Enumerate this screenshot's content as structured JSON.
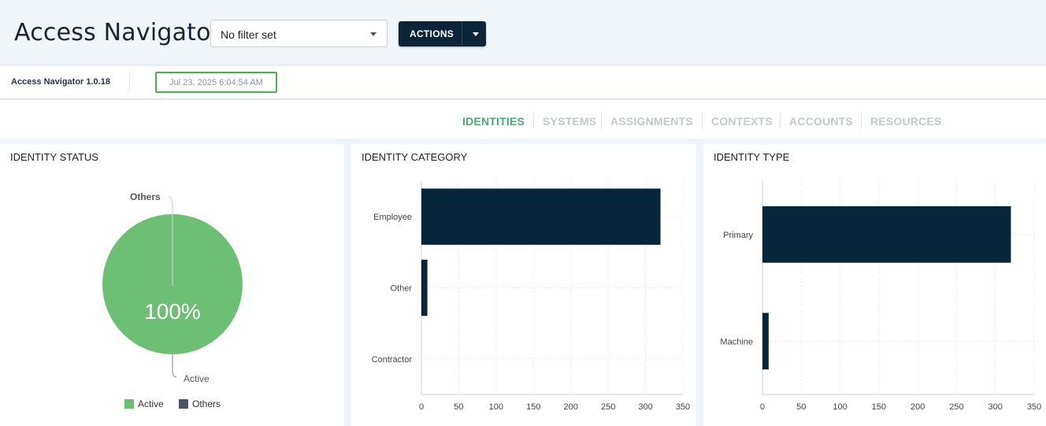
{
  "header": {
    "title": "Access Navigator",
    "filter": {
      "selected": "No filter set"
    },
    "actions_label": "ACTIONS"
  },
  "infobar": {
    "version": "Access Navigator 1.0.18",
    "timestamp": "Jul 23, 2025 6:04:54 AM"
  },
  "tabs": [
    {
      "label": "IDENTITIES",
      "active": true
    },
    {
      "label": "SYSTEMS",
      "active": false
    },
    {
      "label": "ASSIGNMENTS",
      "active": false
    },
    {
      "label": "CONTEXTS",
      "active": false
    },
    {
      "label": "ACCOUNTS",
      "active": false
    },
    {
      "label": "RESOURCES",
      "active": false
    }
  ],
  "panels": {
    "status": {
      "title": "IDENTITY STATUS"
    },
    "category": {
      "title": "IDENTITY CATEGORY"
    },
    "type": {
      "title": "IDENTITY TYPE"
    }
  },
  "colors": {
    "active": "#6dbf73",
    "others": "#4b5566",
    "bar": "#082639",
    "accent": "#4fa677",
    "timestamp_border": "#4caf50"
  },
  "chart_data": [
    {
      "type": "pie",
      "title": "IDENTITY STATUS",
      "slices": [
        {
          "label": "Active",
          "value": 100
        },
        {
          "label": "Others",
          "value": 0
        }
      ],
      "center_label": "100%",
      "legend": [
        "Active",
        "Others"
      ],
      "legend_position": "bottom"
    },
    {
      "type": "bar",
      "orientation": "horizontal",
      "title": "IDENTITY CATEGORY",
      "categories": [
        "Employee",
        "Other",
        "Contractor"
      ],
      "values": [
        320,
        8,
        0
      ],
      "xlim": [
        0,
        350
      ],
      "xticks": [
        0,
        50,
        100,
        150,
        200,
        250,
        300,
        350
      ],
      "grid": true
    },
    {
      "type": "bar",
      "orientation": "horizontal",
      "title": "IDENTITY TYPE",
      "categories": [
        "Primary",
        "Machine"
      ],
      "values": [
        320,
        8
      ],
      "xlim": [
        0,
        350
      ],
      "xticks": [
        0,
        50,
        100,
        150,
        200,
        250,
        300,
        350
      ],
      "grid": true
    }
  ]
}
